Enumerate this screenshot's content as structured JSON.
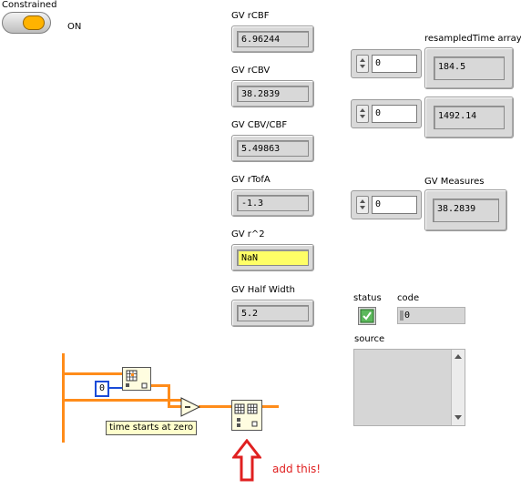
{
  "constrained": {
    "label": "Constrained",
    "state": "ON"
  },
  "indicators": [
    {
      "label": "GV rCBF",
      "value": "6.96244"
    },
    {
      "label": "GV rCBV",
      "value": "38.2839"
    },
    {
      "label": "GV CBV/CBF",
      "value": "5.49863"
    },
    {
      "label": "GV rTofA",
      "value": "-1.3"
    },
    {
      "label": "GV r^2",
      "value": "NaN"
    },
    {
      "label": "GV Half Width",
      "value": "5.2"
    }
  ],
  "resampled": {
    "label": "resampledTime array",
    "rows": [
      {
        "index": "0",
        "value": "184.5"
      },
      {
        "index": "0",
        "value": "1492.14"
      }
    ]
  },
  "measures": {
    "label": "GV Measures",
    "index": "0",
    "value": "38.2839"
  },
  "error_cluster": {
    "status_label": "status",
    "code_label": "code",
    "code_value": "0",
    "source_label": "source",
    "source_value": ""
  },
  "diagram": {
    "constant": "0",
    "comment": "time starts at zero",
    "annotation": "add this!"
  },
  "colors": {
    "wire": "#ff8c1a",
    "highlight": "#ffff66",
    "arrow": "#e02020",
    "check": "#1f8f1f"
  }
}
